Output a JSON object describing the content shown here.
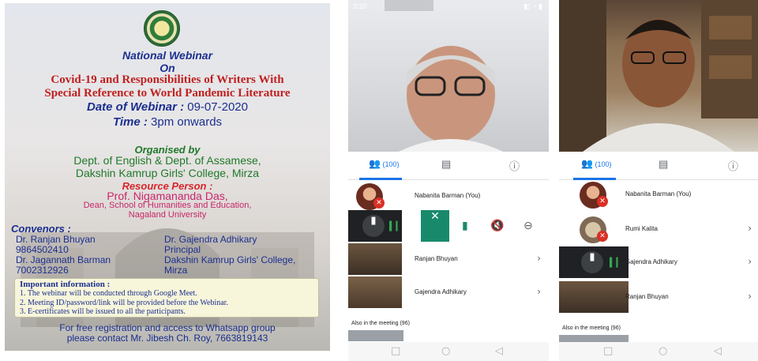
{
  "poster": {
    "heading": "National Webinar",
    "on": "On",
    "title_line1": "Covid-19 and Responsibilities of Writers With",
    "title_line2": "Special Reference to World Pandemic Literature",
    "date_label": "Date of Webinar :",
    "date_value": "09-07-2020",
    "time_label": "Time :",
    "time_value": "3pm onwards",
    "organised_label": "Organised by",
    "organiser_line1": "Dept. of English & Dept. of Assamese,",
    "organiser_line2": "Dakshin Kamrup Girls' College, Mirza",
    "resource_label": "Resource Person :",
    "resource_name": "Prof. Nigamananda Das,",
    "resource_line1": "Dean, School of Humanities and Education,",
    "resource_line2": "Nagaland University",
    "convenors_label": "Convenors :",
    "convenor1_name": "Dr. Ranjan Bhuyan",
    "convenor1_phone": "9864502410",
    "convenor2_name": "Dr. Jagannath Barman",
    "convenor2_phone": "7002312926",
    "convenor3_name": "Dr. Gajendra Adhikary",
    "convenor3_role": "Principal",
    "convenor3_org": "Dakshin Kamrup Girls' College,",
    "convenor3_place": "Mirza",
    "info_title": "Important information :",
    "info_items": [
      "1. The webinar will be conducted through Google Meet.",
      "2. Meeting ID/password/link will be provided before the Webinar.",
      "3. E-certificates will be issued to all the participants."
    ],
    "registration_line1": "For free registration and access to Whatsapp group",
    "registration_line2": "please contact Mr. Jibesh Ch. Roy, 7663819143"
  },
  "phone1": {
    "status_time": "3:20",
    "people_count": "(100)",
    "participants": [
      {
        "name": "Nabanita Barman (You)"
      },
      {
        "name": "Ranjan Bhuyan"
      },
      {
        "name": "Gajendra Adhikary"
      }
    ],
    "also_label": "Also in the meeting (96)"
  },
  "phone2": {
    "people_count": "(100)",
    "participants": [
      {
        "name": "Nabanita Barman (You)"
      },
      {
        "name": "Rumi Kalita"
      },
      {
        "name": "Gajendra Adhikary"
      },
      {
        "name": "Ranjan Bhuyan"
      }
    ],
    "also_label": "Also in the meeting (96)"
  },
  "icons": [
    "people-icon",
    "chat-icon",
    "info-icon",
    "mic-off-icon",
    "pin-icon",
    "mute-icon",
    "remove-icon",
    "close-icon",
    "chevron-right-icon",
    "back-nav-icon",
    "home-nav-icon",
    "recents-nav-icon"
  ],
  "colors": {
    "accent": "#1a73e8",
    "muted_red": "#d93025",
    "selected_teal": "#188a6b",
    "poster_blue": "#1b2f8f",
    "poster_red": "#c0201f",
    "poster_green": "#1f7a2a"
  }
}
